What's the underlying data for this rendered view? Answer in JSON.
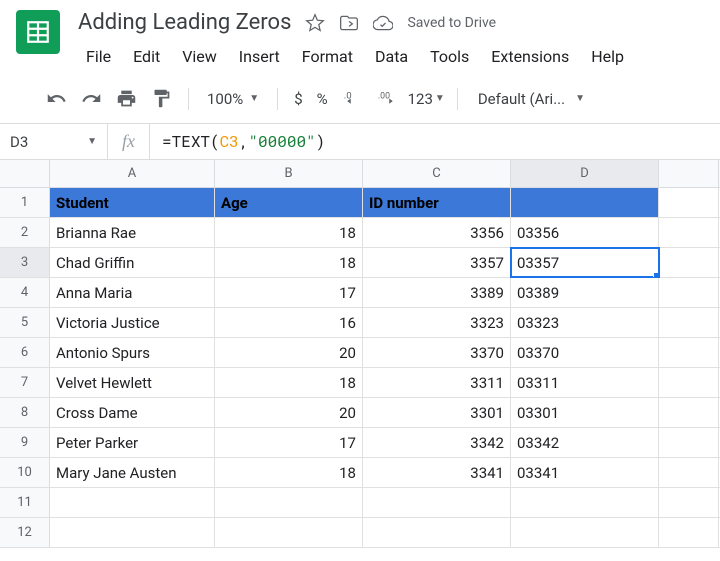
{
  "doc": {
    "title": "Adding Leading Zeros",
    "saved": "Saved to Drive"
  },
  "menu": {
    "file": "File",
    "edit": "Edit",
    "view": "View",
    "insert": "Insert",
    "format": "Format",
    "data": "Data",
    "tools": "Tools",
    "extensions": "Extensions",
    "help": "Help"
  },
  "toolbar": {
    "zoom": "100%",
    "currency": "$",
    "percent": "%",
    "dec_dec": ".0",
    "inc_dec": ".00",
    "numfmt": "123",
    "font": "Default (Ari..."
  },
  "namebox": "D3",
  "formula": {
    "eq": "=",
    "fn": "TEXT",
    "open": "(",
    "ref": "C3",
    "comma": ",",
    "str": "\"00000\"",
    "close": ")"
  },
  "cols": {
    "A": "A",
    "B": "B",
    "C": "C",
    "D": "D"
  },
  "rows": {
    "r1": "1",
    "r2": "2",
    "r3": "3",
    "r4": "4",
    "r5": "5",
    "r6": "6",
    "r7": "7",
    "r8": "8",
    "r9": "9",
    "r10": "10",
    "r11": "11",
    "r12": "12"
  },
  "table": {
    "headers": {
      "student": "Student",
      "age": "Age",
      "id": "ID number"
    },
    "data": [
      {
        "student": "Brianna Rae",
        "age": "18",
        "id": "3356",
        "padded": "03356"
      },
      {
        "student": "Chad Griffin",
        "age": "18",
        "id": "3357",
        "padded": "03357"
      },
      {
        "student": "Anna Maria",
        "age": "17",
        "id": "3389",
        "padded": "03389"
      },
      {
        "student": "Victoria Justice",
        "age": "16",
        "id": "3323",
        "padded": "03323"
      },
      {
        "student": "Antonio Spurs",
        "age": "20",
        "id": "3370",
        "padded": "03370"
      },
      {
        "student": "Velvet Hewlett",
        "age": "18",
        "id": "3311",
        "padded": "03311"
      },
      {
        "student": "Cross Dame",
        "age": "20",
        "id": "3301",
        "padded": "03301"
      },
      {
        "student": "Peter Parker",
        "age": "17",
        "id": "3342",
        "padded": "03342"
      },
      {
        "student": "Mary Jane Austen",
        "age": "18",
        "id": "3341",
        "padded": "03341"
      }
    ]
  }
}
